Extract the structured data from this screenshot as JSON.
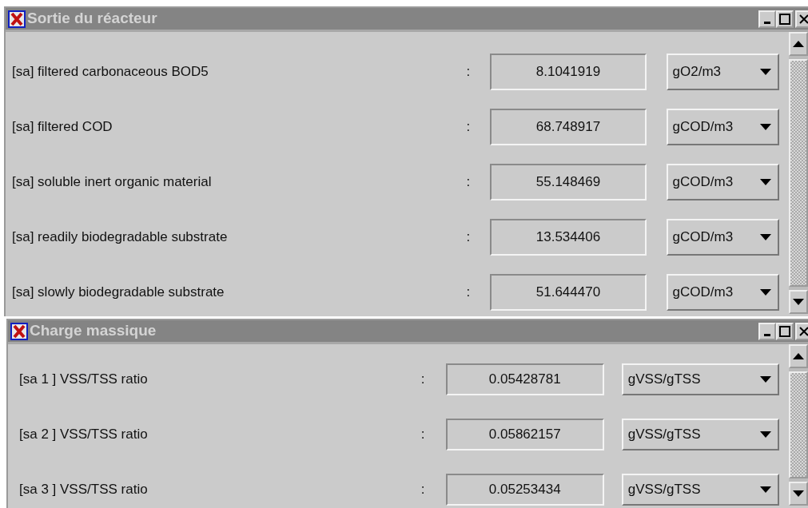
{
  "windows": [
    {
      "title": "Sortie du réacteur",
      "rows": [
        {
          "label": "[sa] filtered carbonaceous BOD5",
          "separator": ":",
          "value": "8.1041919",
          "unit": "gO2/m3"
        },
        {
          "label": "[sa] filtered COD",
          "separator": ":",
          "value": "68.748917",
          "unit": "gCOD/m3"
        },
        {
          "label": "[sa] soluble inert organic material",
          "separator": ":",
          "value": "55.148469",
          "unit": "gCOD/m3"
        },
        {
          "label": "[sa] readily biodegradable substrate",
          "separator": ":",
          "value": "13.534406",
          "unit": "gCOD/m3"
        },
        {
          "label": "[sa] slowly biodegradable substrate",
          "separator": ":",
          "value": "51.644470",
          "unit": "gCOD/m3"
        }
      ]
    },
    {
      "title": "Charge massique",
      "rows": [
        {
          "label": "[sa 1 ] VSS/TSS ratio",
          "separator": ":",
          "value": "0.05428781",
          "unit": "gVSS/gTSS"
        },
        {
          "label": "[sa 2 ] VSS/TSS ratio",
          "separator": ":",
          "value": "0.05862157",
          "unit": "gVSS/gTSS"
        },
        {
          "label": "[sa 3 ] VSS/TSS ratio",
          "separator": ":",
          "value": "0.05253434",
          "unit": "gVSS/gTSS"
        }
      ]
    }
  ]
}
